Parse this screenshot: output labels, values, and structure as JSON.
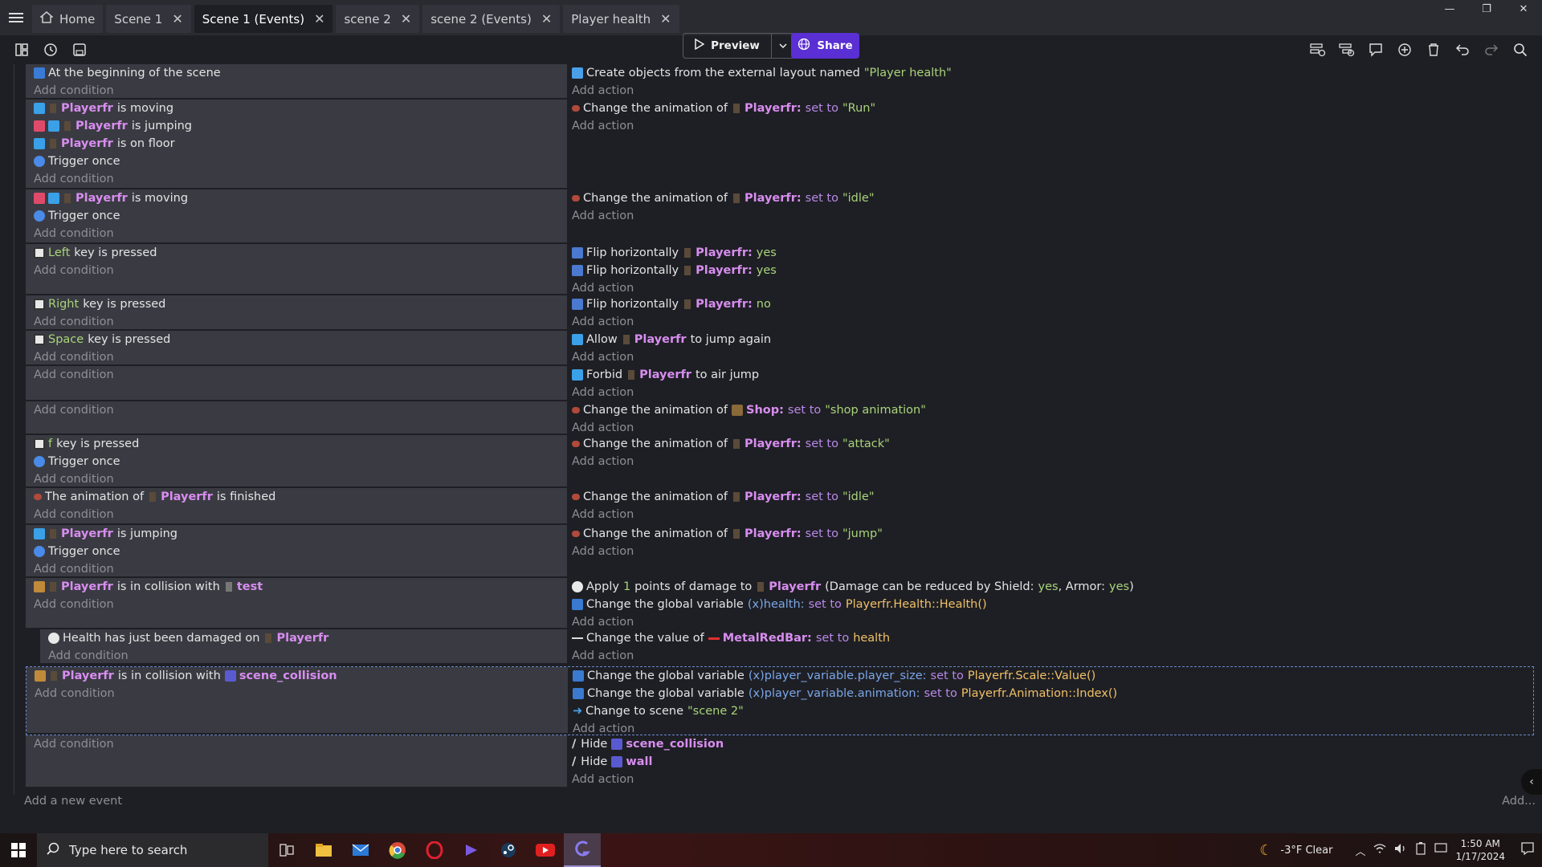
{
  "tabs": [
    {
      "label": "Home",
      "icon": "home-icon",
      "closable": false
    },
    {
      "label": "Scene 1",
      "closable": true
    },
    {
      "label": "Scene 1 (Events)",
      "closable": true,
      "active": true
    },
    {
      "label": "scene 2",
      "closable": true
    },
    {
      "label": "scene 2 (Events)",
      "closable": true
    },
    {
      "label": "Player health",
      "closable": true
    }
  ],
  "toolbar": {
    "preview_label": "Preview",
    "share_label": "Share"
  },
  "ui": {
    "add_condition": "Add condition",
    "add_action": "Add action",
    "add_event": "Add a new event",
    "add_more": "Add..."
  },
  "events": [
    {
      "conditions": [
        "At the beginning of the scene"
      ],
      "actions": [
        "Create objects from the external layout named",
        "\"Player health\""
      ]
    },
    {
      "conditions": {
        "c1": {
          "obj": "Playerfr",
          "text": "is moving"
        },
        "c2": {
          "obj": "Playerfr",
          "text": "is jumping"
        },
        "c3": {
          "obj": "Playerfr",
          "text": "is on floor"
        },
        "c4": {
          "text": "Trigger once"
        }
      },
      "actions": {
        "a1": {
          "prefix": "Change the animation of",
          "obj": "Playerfr:",
          "kw": "set to",
          "val": "\"Run\""
        }
      }
    },
    {
      "conditions": {
        "c1": {
          "obj": "Playerfr",
          "text": "is moving"
        },
        "c2": {
          "text": "Trigger once"
        }
      },
      "actions": {
        "a1": {
          "prefix": "Change the animation of",
          "obj": "Playerfr:",
          "kw": "set to",
          "val": "\"idle\""
        }
      }
    },
    {
      "conditions": {
        "c1": {
          "key": "Left",
          "text": "key is pressed"
        }
      },
      "actions": {
        "a1": {
          "prefix": "Flip horizontally",
          "obj": "Playerfr:",
          "val": "yes"
        },
        "a2": {
          "prefix": "Flip horizontally",
          "obj": "Playerfr:",
          "val": "yes"
        }
      }
    },
    {
      "conditions": {
        "c1": {
          "key": "Right",
          "text": "key is pressed"
        }
      },
      "actions": {
        "a1": {
          "prefix": "Flip horizontally",
          "obj": "Playerfr:",
          "val": "no"
        }
      }
    },
    {
      "conditions": {
        "c1": {
          "key": "Space",
          "text": "key is pressed"
        }
      },
      "actions": {
        "a1": {
          "prefix": "Allow",
          "obj": "Playerfr",
          "suffix": "to jump again"
        }
      }
    },
    {
      "conditions": {},
      "actions": {
        "a1": {
          "prefix": "Forbid",
          "obj": "Playerfr",
          "suffix": "to air jump"
        }
      }
    },
    {
      "conditions": {},
      "actions": {
        "a1": {
          "prefix": "Change the animation of",
          "obj": "Shop:",
          "kw": "set to",
          "val": "\"shop animation\""
        }
      }
    },
    {
      "conditions": {
        "c1": {
          "key": "f",
          "text": "key is pressed"
        },
        "c2": {
          "text": "Trigger once"
        }
      },
      "actions": {
        "a1": {
          "prefix": "Change the animation of",
          "obj": "Playerfr:",
          "kw": "set to",
          "val": "\"attack\""
        }
      }
    },
    {
      "conditions": {
        "c1": {
          "prefix": "The animation of",
          "obj": "Playerfr",
          "text": "is finished"
        }
      },
      "actions": {
        "a1": {
          "prefix": "Change the animation of",
          "obj": "Playerfr:",
          "kw": "set to",
          "val": "\"idle\""
        }
      }
    },
    {
      "conditions": {
        "c1": {
          "obj": "Playerfr",
          "text": "is jumping"
        },
        "c2": {
          "text": "Trigger once"
        }
      },
      "actions": {
        "a1": {
          "prefix": "Change the animation of",
          "obj": "Playerfr:",
          "kw": "set to",
          "val": "\"jump\""
        }
      }
    },
    {
      "conditions": {
        "c1": {
          "obj": "Playerfr",
          "text": "is in collision with",
          "obj2": "test"
        }
      },
      "actions": {
        "a1": {
          "p1": "Apply",
          "n": "1",
          "p2": "points of damage to",
          "obj": "Playerfr",
          "p3": "(Damage can be reduced by Shield:",
          "v1": "yes",
          "p4": ", Armor:",
          "v2": "yes",
          "p5": ")"
        },
        "a2": {
          "prefix": "Change the global variable",
          "var": "health:",
          "kw": "set to",
          "expr": "Playerfr.Health::Health()"
        }
      }
    },
    {
      "conditions": {
        "c1": {
          "text": "Health has just been damaged on",
          "obj": "Playerfr"
        }
      },
      "actions": {
        "a1": {
          "prefix": "Change the value of",
          "obj": "MetalRedBar:",
          "kw": "set to",
          "val": "health"
        }
      }
    },
    {
      "conditions": {
        "c1": {
          "obj": "Playerfr",
          "text": "is in collision with",
          "obj2": "scene_collision"
        }
      },
      "actions": {
        "a1": {
          "prefix": "Change the global variable",
          "var": "player_variable.player_size:",
          "kw": "set to",
          "expr": "Playerfr.Scale::Value()"
        },
        "a2": {
          "prefix": "Change the global variable",
          "var": "player_variable.animation:",
          "kw": "set to",
          "expr": "Playerfr.Animation::Index()"
        },
        "a3": {
          "prefix": "Change to scene",
          "val": "\"scene 2\""
        }
      }
    },
    {
      "conditions": {},
      "actions": {
        "a1": {
          "prefix": "Hide",
          "obj": "scene_collision"
        },
        "a2": {
          "prefix": "Hide",
          "obj": "wall"
        }
      }
    }
  ],
  "taskbar": {
    "search_placeholder": "Type here to search",
    "weather": "-3°F  Clear",
    "time": "1:50 AM",
    "date": "1/17/2024"
  },
  "colors": {
    "object": "#d88df0",
    "keyword": "#b988e8",
    "string": "#a9d47a",
    "variable": "#7ba6e8",
    "expression": "#f0c066",
    "share": "#5a2fd3"
  }
}
